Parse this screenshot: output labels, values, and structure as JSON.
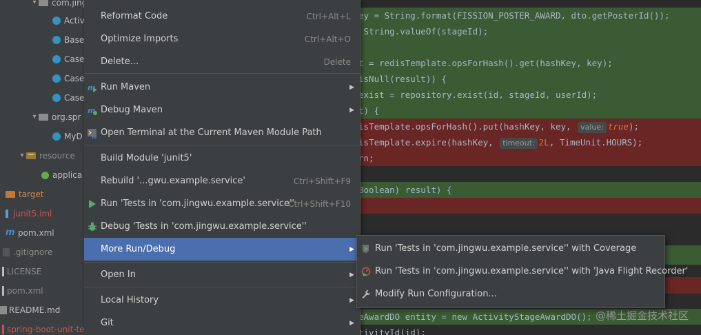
{
  "project_tree": {
    "rows": [
      {
        "text": "com.jingwu"
      },
      {
        "text": "Activ"
      },
      {
        "text": "Base"
      },
      {
        "text": "Case"
      },
      {
        "text": "Case"
      },
      {
        "text": "Case"
      },
      {
        "text": "org.spr"
      },
      {
        "text": "MyD"
      },
      {
        "text": "resource"
      },
      {
        "text": "applica"
      },
      {
        "text": "target"
      },
      {
        "text": "junit5.iml"
      },
      {
        "text": "pom.xml"
      },
      {
        "text": ".gitignore"
      },
      {
        "text": "LICENSE"
      },
      {
        "text": "pom.xml"
      },
      {
        "text": "README.md"
      },
      {
        "text": "spring-boot-unit-te"
      }
    ]
  },
  "editor": {
    "lines": [
      "ey = String.format(FISSION_POSTER_AWARD, dto.getPosterId());",
      " String.valueOf(stageId);",
      "",
      "t = redisTemplate.opsForHash().get(hashKey, key);",
      "isNull(result)) {",
      "exist = repository.exist(id, stageId, userId);",
      "t) {",
      "isTemplate.opsForHash().put(hashKey, key,",
      "isTemplate.expire(hashKey,",
      "rn;",
      "",
      "Boolean) result) {",
      "",
      "eAwardDO entity = new ActivityStageAwardDO();",
      "tivityId(id);"
    ],
    "hint_value_label": "value:",
    "hint_value": "true",
    "hint_timeout_label": "timeout:",
    "hint_timeout_value": "2L",
    "hint_timeout_rest": ", TimeUnit.HOURS);",
    "watermark": "@稀土掘金技术社区"
  },
  "context_menu": {
    "items": [
      {
        "label": "Reformat Code",
        "shortcut": "Ctrl+Alt+L",
        "icon": ""
      },
      {
        "label": "Optimize Imports",
        "shortcut": "Ctrl+Alt+O",
        "icon": ""
      },
      {
        "label": "Delete...",
        "shortcut": "Delete",
        "icon": ""
      },
      {
        "label": "Run Maven",
        "shortcut": "",
        "icon": "maven-run-icon",
        "submenu": true
      },
      {
        "label": "Debug Maven",
        "shortcut": "",
        "icon": "maven-debug-icon",
        "submenu": true
      },
      {
        "label": "Open Terminal at the Current Maven Module Path",
        "shortcut": "",
        "icon": "terminal-icon"
      },
      {
        "label": "Build Module 'junit5'",
        "shortcut": "",
        "icon": ""
      },
      {
        "label": "Rebuild '...gwu.example.service'",
        "shortcut": "Ctrl+Shift+F9",
        "icon": ""
      },
      {
        "label": "Run 'Tests in 'com.jingwu.example.service''",
        "shortcut": "Ctrl+Shift+F10",
        "icon": "run-icon"
      },
      {
        "label": "Debug 'Tests in 'com.jingwu.example.service''",
        "shortcut": "",
        "icon": "debug-icon"
      },
      {
        "label": "More Run/Debug",
        "shortcut": "",
        "icon": "",
        "submenu": true,
        "selected": true
      },
      {
        "label": "Open In",
        "shortcut": "",
        "icon": "",
        "submenu": true
      },
      {
        "label": "Local History",
        "shortcut": "",
        "icon": "",
        "submenu": true
      },
      {
        "label": "Git",
        "shortcut": "",
        "icon": "",
        "submenu": true
      }
    ]
  },
  "submenu": {
    "items": [
      {
        "label": "Run 'Tests in 'com.jingwu.example.service'' with Coverage",
        "icon": "coverage-icon"
      },
      {
        "label": "Run 'Tests in 'com.jingwu.example.service'' with 'Java Flight Recorder'",
        "icon": "profiler-icon"
      },
      {
        "label": "Modify Run Configuration...",
        "icon": "wrench-icon"
      }
    ]
  },
  "colors": {
    "menu_bg": "#3c3f41",
    "selection": "#4b6eaf",
    "diff_green": "#3a5b34",
    "diff_red": "#6a2525",
    "editor_bg": "#2b2b2b"
  }
}
